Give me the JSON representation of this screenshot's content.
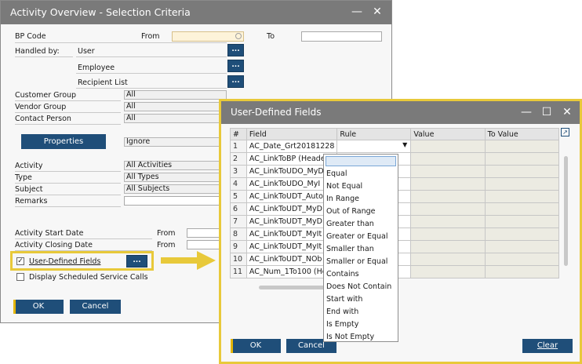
{
  "left_window": {
    "title": "Activity Overview - Selection Criteria",
    "bp_code_label": "BP Code",
    "from_label": "From",
    "to_label": "To",
    "handled_by_label": "Handled by:",
    "user_label": "User",
    "employee_label": "Employee",
    "recipient_list_label": "Recipient List",
    "customer_group_label": "Customer Group",
    "customer_group_value": "All",
    "vendor_group_label": "Vendor Group",
    "vendor_group_value": "All",
    "contact_person_label": "Contact Person",
    "contact_person_value": "All",
    "properties_button": "Properties",
    "properties_value": "Ignore",
    "activity_label": "Activity",
    "activity_value": "All Activities",
    "type_label": "Type",
    "type_value": "All Types",
    "subject_label": "Subject",
    "subject_value": "All Subjects",
    "remarks_label": "Remarks",
    "activity_start_label": "Activity Start Date",
    "activity_closing_label": "Activity Closing Date",
    "start_from_label": "From",
    "closing_from_label": "From",
    "udf_checkbox_label": "User-Defined Fields",
    "udf_checked": true,
    "display_scheduled_label": "Display Scheduled Service Calls",
    "display_scheduled_checked": false,
    "ok_button": "OK",
    "cancel_button": "Cancel",
    "dots": "..."
  },
  "right_window": {
    "title": "User-Defined Fields",
    "columns": [
      "#",
      "Field",
      "Rule",
      "Value",
      "To Value"
    ],
    "rows": [
      {
        "num": "1",
        "field": "AC_Date_Grt20181228"
      },
      {
        "num": "2",
        "field": "AC_LinkToBP (Heade"
      },
      {
        "num": "3",
        "field": "AC_LinkToUDO_MyD"
      },
      {
        "num": "4",
        "field": "AC_LinkToUDO_MyI"
      },
      {
        "num": "5",
        "field": "AC_LinkToUDT_Auto"
      },
      {
        "num": "6",
        "field": "AC_LinkToUDT_MyD"
      },
      {
        "num": "7",
        "field": "AC_LinkToUDT_MyD"
      },
      {
        "num": "8",
        "field": "AC_LinkToUDT_MyIt"
      },
      {
        "num": "9",
        "field": "AC_LinkToUDT_MyIt"
      },
      {
        "num": "10",
        "field": "AC_LinkToUDT_NOb"
      },
      {
        "num": "11",
        "field": "AC_Num_1To100 (He"
      }
    ],
    "rule_options": [
      "",
      "Equal",
      "Not Equal",
      "In Range",
      "Out of Range",
      "Greater than",
      "Greater or Equal",
      "Smaller than",
      "Smaller or Equal",
      "Contains",
      "Does Not Contain",
      "Start with",
      "End with",
      "Is Empty",
      "Is Not Empty"
    ],
    "ok_button": "OK",
    "cancel_button": "Cancel",
    "clear_button": "Clear"
  },
  "colors": {
    "title_bar": "#7a7a7a",
    "button_blue": "#1f4e79",
    "accent_gold": "#e3b505",
    "highlight_border": "#e8c93a"
  }
}
